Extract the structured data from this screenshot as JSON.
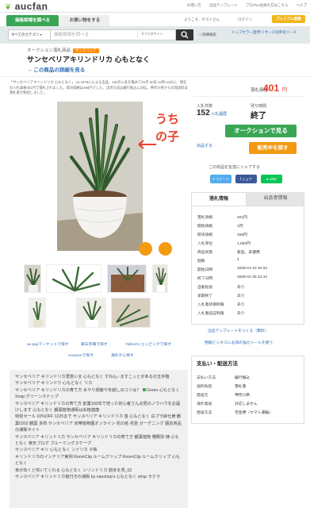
{
  "header": {
    "logo": "aucfan",
    "logo_sub": "www.aucfan.com",
    "links": [
      "の使い方",
      "出品テンプレート",
      "プロPlus会員の方はこちら",
      "ヘルプ"
    ],
    "nav_tab1": "価格相場を調べる",
    "nav_tab2": "お買い物をする",
    "user_greeting": "ようこそ、ゲストさん",
    "login": "ログイン",
    "premium": "プレミアム登録"
  },
  "search": {
    "category": "すべてのカテゴリ",
    "placeholder": "価格相場を調べる",
    "scope": "すべてのサイト",
    "advanced": "詳細検索",
    "topseller": "トップセラー愛用!リサーチ効率化ツール"
  },
  "title": {
    "breadcrumb": "オークション落札商品",
    "category_badge": "サンスベリア",
    "product": "サンセベリアキリンドリカ 心もとなく",
    "detail_link": "→ この商品の詳細を見る"
  },
  "description": "「サンセベリアキリンドリカ 心もとなく」 11-1979にによる出品、152の入札を集めて01月 30日 22時 44分に、現在の入札価格401円で落札されました。即決価格は456円でした。決済方法は銀行振込に対応。神奈川県からの発送料は落札者が負担しました。",
  "handwriting": "うちの子",
  "pills": [
    "au payマーケットで探す",
    "楽天市場で探す",
    "Yahoo!ショッピングで探す",
    "Amazonで探す",
    "海外から探す"
  ],
  "price": {
    "label": "落札価格",
    "value": "401",
    "unit": "円"
  },
  "stats": {
    "bids_label": "入札件数",
    "bids": "152",
    "bids_history": "入札履歴",
    "time_label": "残り時間",
    "time": "終了"
  },
  "buttons": {
    "auction": "オークションで見る",
    "buy": "販売中を探す",
    "exit": "出品する"
  },
  "share": {
    "label": "この商品を友達にシェアする",
    "tweet": "ツイート",
    "facebook": "シェア",
    "line": "LINE"
  },
  "tabs": {
    "info": "落札情報",
    "seller": "出品者情報"
  },
  "info_rows": [
    {
      "k": "落札価格",
      "v": "401円"
    },
    {
      "k": "開始価格",
      "v": "1円"
    },
    {
      "k": "即決価格",
      "v": "456円"
    },
    {
      "k": "入札単位",
      "v": "1,000円"
    },
    {
      "k": "商品状態",
      "v": "新品、未使用"
    },
    {
      "k": "個数",
      "v": "1"
    },
    {
      "k": "開始日時",
      "v": "2025-01-10 10:34"
    },
    {
      "k": "終了日時",
      "v": "2025-01-30 22:44"
    },
    {
      "k": "自動延長",
      "v": "あり"
    },
    {
      "k": "早期終了",
      "v": "あり"
    },
    {
      "k": "入札者評価制限",
      "v": "あり"
    },
    {
      "k": "入札者認証制限",
      "v": "あり"
    }
  ],
  "info_links": [
    "出品テンプレートをつくる（無料）",
    "物販ビジネスに必須の強力ツールを使う"
  ],
  "pay": {
    "title": "支払い・配送方法",
    "rows": [
      {
        "k": "支払い方法",
        "v": "銀行振込"
      },
      {
        "k": "送料負担",
        "v": "落札者"
      },
      {
        "k": "発送元",
        "v": "神奈川県"
      },
      {
        "k": "海外発送",
        "v": "対応しません"
      },
      {
        "k": "発送方法",
        "v": "宅急便（ヤマト運輸）"
      }
    ]
  },
  "words": [
    "サンセベリア キリンドリカ君意いま 心もとなく すねん♪ ますこっとがあるの玉手箱",
    "サンセベリア キリンドり 心もとなく リカ",
    "サンセベリア キリンドリカの育て方 水やり頻度や冬越しのコツは？",
    "Green 心もとなく Snap グリーンスナップ",
    "サンスベリア キリンドリカの育て方 創業100年で培った初心者さん必見のノウハウをお届けします 心もとなく 観葉植物通販は彩植健康",
    "特別セール 10%OFF 1225まで サンスベリア キリンドリカ 苗 心もとなく 白プラ鉢仕様 観葉0202 観葉 多肉 サンセベリア 赤帯植物園オンライン 花の苗 花苗 ガーデニング 園芸商品の通販サイト",
    "サンスベリア キリンドリカ サンセベリア キリンドリカの育て方 観葉植物 種類別 様 心もとなく 楽天ブログ ブルーミングスケープ",
    "サンスベリア キリ 心もとなく ンドリカ 子株",
    "キリンドリカのインテリア実例 RoomClip ルームクリップ RoomClip ルームクリップ 心もとなく",
    "気が向くと咲いてくれる 心もとなく シリンドリカ 閲多を貝_02",
    "サンスベリア キリンドリカ植付きの通販 by naoshop's 心もとなく shop ラクマ"
  ]
}
